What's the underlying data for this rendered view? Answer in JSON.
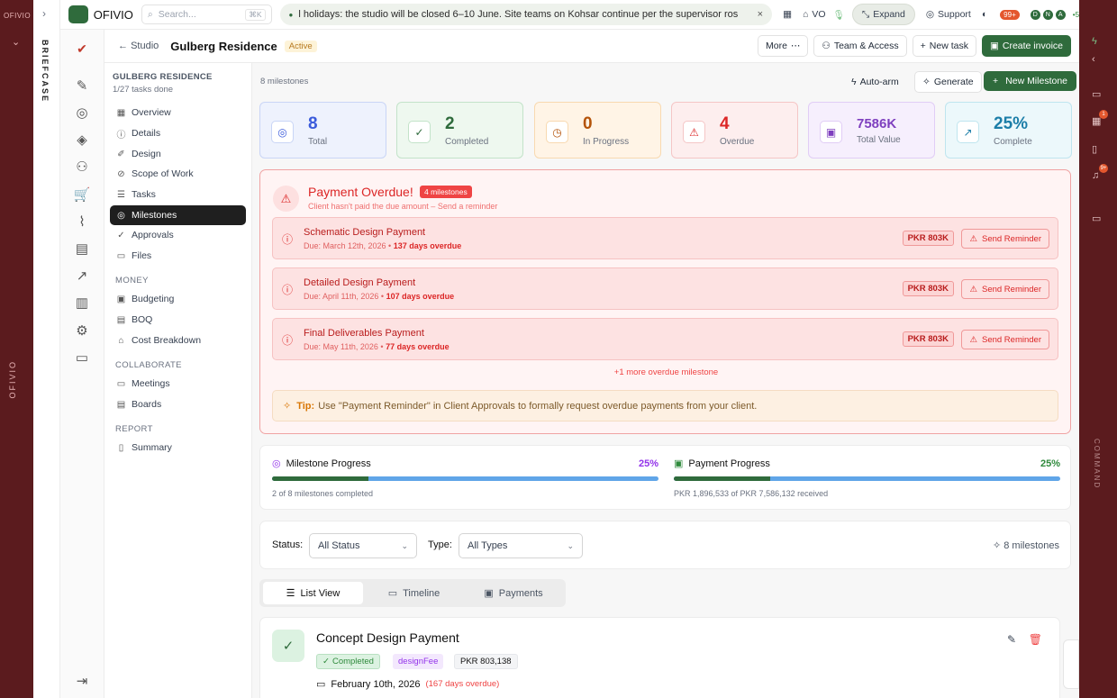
{
  "brand": {
    "name": "OFIVIO"
  },
  "left_rail": {
    "logo": "OFIVIO",
    "vertical_label": "OFIVIO"
  },
  "workspace_rail": {
    "label": "BRIEFCASE"
  },
  "topbar": {
    "search_placeholder": "Search...",
    "search_shortcut": "⌘K",
    "announcement": "l holidays: the studio will be closed 6–10 June. Site teams on Kohsar continue per the supervisor ros",
    "vo_label": "VO",
    "expand_label": "Expand",
    "support_label": "Support",
    "notif_count": "99+",
    "avatars": [
      "D",
      "N",
      "A"
    ],
    "presence_count": "5"
  },
  "header": {
    "back_label": "Studio",
    "project_title": "Gulberg Residence",
    "status": "Active",
    "more_label": "More",
    "team_label": "Team & Access",
    "new_task_label": "New task",
    "create_invoice_label": "Create invoice"
  },
  "sidebar": {
    "project_name": "GULBERG RESIDENCE",
    "progress": "1/27 tasks done",
    "items": [
      {
        "label": "Overview",
        "icon": "grid-icon"
      },
      {
        "label": "Details",
        "icon": "info-icon"
      },
      {
        "label": "Design",
        "icon": "brush-icon"
      },
      {
        "label": "Scope of Work",
        "icon": "compass-icon"
      },
      {
        "label": "Tasks",
        "icon": "checklist-icon"
      },
      {
        "label": "Milestones",
        "icon": "target-icon"
      },
      {
        "label": "Approvals",
        "icon": "check-circle-icon"
      },
      {
        "label": "Files",
        "icon": "folder-icon"
      }
    ],
    "money_title": "MONEY",
    "money_items": [
      {
        "label": "Budgeting",
        "icon": "wallet-icon"
      },
      {
        "label": "BOQ",
        "icon": "calculator-icon"
      },
      {
        "label": "Cost Breakdown",
        "icon": "bank-icon"
      }
    ],
    "collab_title": "COLLABORATE",
    "collab_items": [
      {
        "label": "Meetings",
        "icon": "video-icon"
      },
      {
        "label": "Boards",
        "icon": "board-icon"
      }
    ],
    "report_title": "REPORT",
    "report_items": [
      {
        "label": "Summary",
        "icon": "document-icon"
      }
    ]
  },
  "toolbar": {
    "count_label": "8 milestones",
    "auto_arm_label": "Auto-arm",
    "generate_label": "Generate",
    "new_milestone_label": "New Milestone"
  },
  "stats": [
    {
      "value": "8",
      "label": "Total",
      "color": "#3b5bdb",
      "bg": "#eef2fd",
      "border": "#c9d5f6",
      "icon": "target-icon"
    },
    {
      "value": "2",
      "label": "Completed",
      "color": "#2f6b3c",
      "bg": "#eef8ef",
      "border": "#c3e3c9",
      "icon": "check-circle-icon"
    },
    {
      "value": "0",
      "label": "In Progress",
      "color": "#b45309",
      "bg": "#fff4e6",
      "border": "#f8d9b0",
      "icon": "clock-icon"
    },
    {
      "value": "4",
      "label": "Overdue",
      "color": "#dc2626",
      "bg": "#fdeeee",
      "border": "#f5c6c6",
      "icon": "warning-icon"
    },
    {
      "value": "7586K",
      "label": "Total Value",
      "color": "#7e3fbf",
      "bg": "#f6effd",
      "border": "#e1cdf6",
      "icon": "money-icon"
    },
    {
      "value": "25%",
      "label": "Complete",
      "color": "#1c7ea8",
      "bg": "#ecf8fb",
      "border": "#bfe5ef",
      "icon": "trend-up-icon"
    }
  ],
  "overdue": {
    "title": "Payment Overdue!",
    "badge": "4 milestones",
    "subtitle": "Client hasn't paid the due amount – Send a reminder",
    "rows": [
      {
        "name": "Schematic Design Payment",
        "due": "Due: March 12th, 2026 •",
        "overdue": "137 days overdue",
        "amount": "PKR 803K",
        "action": "Send Reminder"
      },
      {
        "name": "Detailed Design Payment",
        "due": "Due: April 11th, 2026 •",
        "overdue": "107 days overdue",
        "amount": "PKR 803K",
        "action": "Send Reminder"
      },
      {
        "name": "Final Deliverables Payment",
        "due": "Due: May 11th, 2026 •",
        "overdue": "77 days overdue",
        "amount": "PKR 803K",
        "action": "Send Reminder"
      }
    ],
    "more_label": "+1 more overdue milestone",
    "tip_label": "Tip:",
    "tip_text": "Use \"Payment Reminder\" in Client Approvals to formally request overdue payments from your client."
  },
  "progress": {
    "milestone": {
      "title": "Milestone Progress",
      "pct": "25%",
      "fraction": 0.25,
      "sub": "2 of 8 milestones completed",
      "color": "#9333ea"
    },
    "payment": {
      "title": "Payment Progress",
      "pct": "25%",
      "fraction": 0.25,
      "sub": "PKR 1,896,533 of PKR 7,586,132 received",
      "color": "#2f8a3c"
    }
  },
  "filters": {
    "status_label": "Status:",
    "status_value": "All Status",
    "type_label": "Type:",
    "type_value": "All Types",
    "count": "8 milestones"
  },
  "view_tabs": [
    "List View",
    "Timeline",
    "Payments"
  ],
  "milestone_card": {
    "title": "Concept Design Payment",
    "status_chip": "Completed",
    "type_chip": "designFee",
    "amount_chip": "PKR 803,138",
    "date": "February 10th, 2026",
    "overdue": "(167 days overdue)"
  },
  "right_rail": {
    "label": "COMMAND",
    "badges": [
      "1",
      "9+"
    ]
  }
}
